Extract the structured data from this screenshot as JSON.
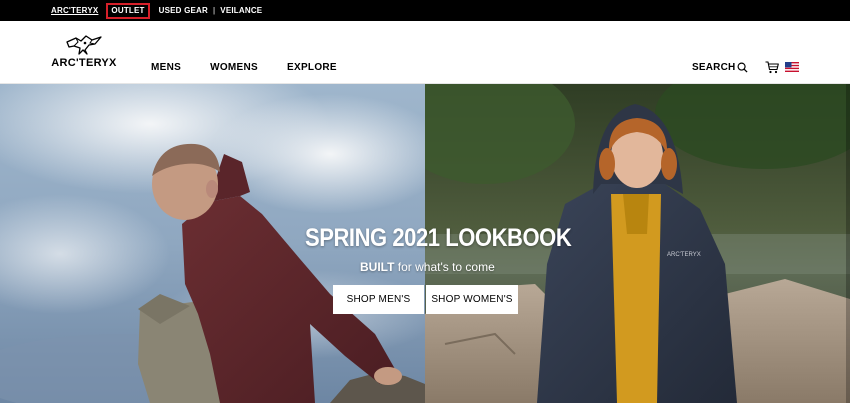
{
  "utility_bar": {
    "brand_link": "ARC'TERYX",
    "outlet_link": "OUTLET",
    "used_gear_link": "USED GEAR",
    "separator": "|",
    "veilance_link": "VEILANCE",
    "highlight_color": "#d6202a"
  },
  "header": {
    "logo_text": "ARC'TERYX",
    "logo_icon": "archaeopteryx-icon",
    "nav": {
      "mens": "MENS",
      "womens": "WOMENS",
      "explore": "EXPLORE"
    },
    "search_label": "SEARCH",
    "search_icon": "search-icon",
    "cart_icon": "cart-icon",
    "region_icon": "us-flag-icon"
  },
  "hero": {
    "title": "SPRING 2021 LOOKBOOK",
    "subtitle_bold": "BUILT",
    "subtitle_rest": " for what's to come",
    "cta_mens": "SHOP MEN'S",
    "cta_womens": "SHOP WOMEN'S"
  }
}
